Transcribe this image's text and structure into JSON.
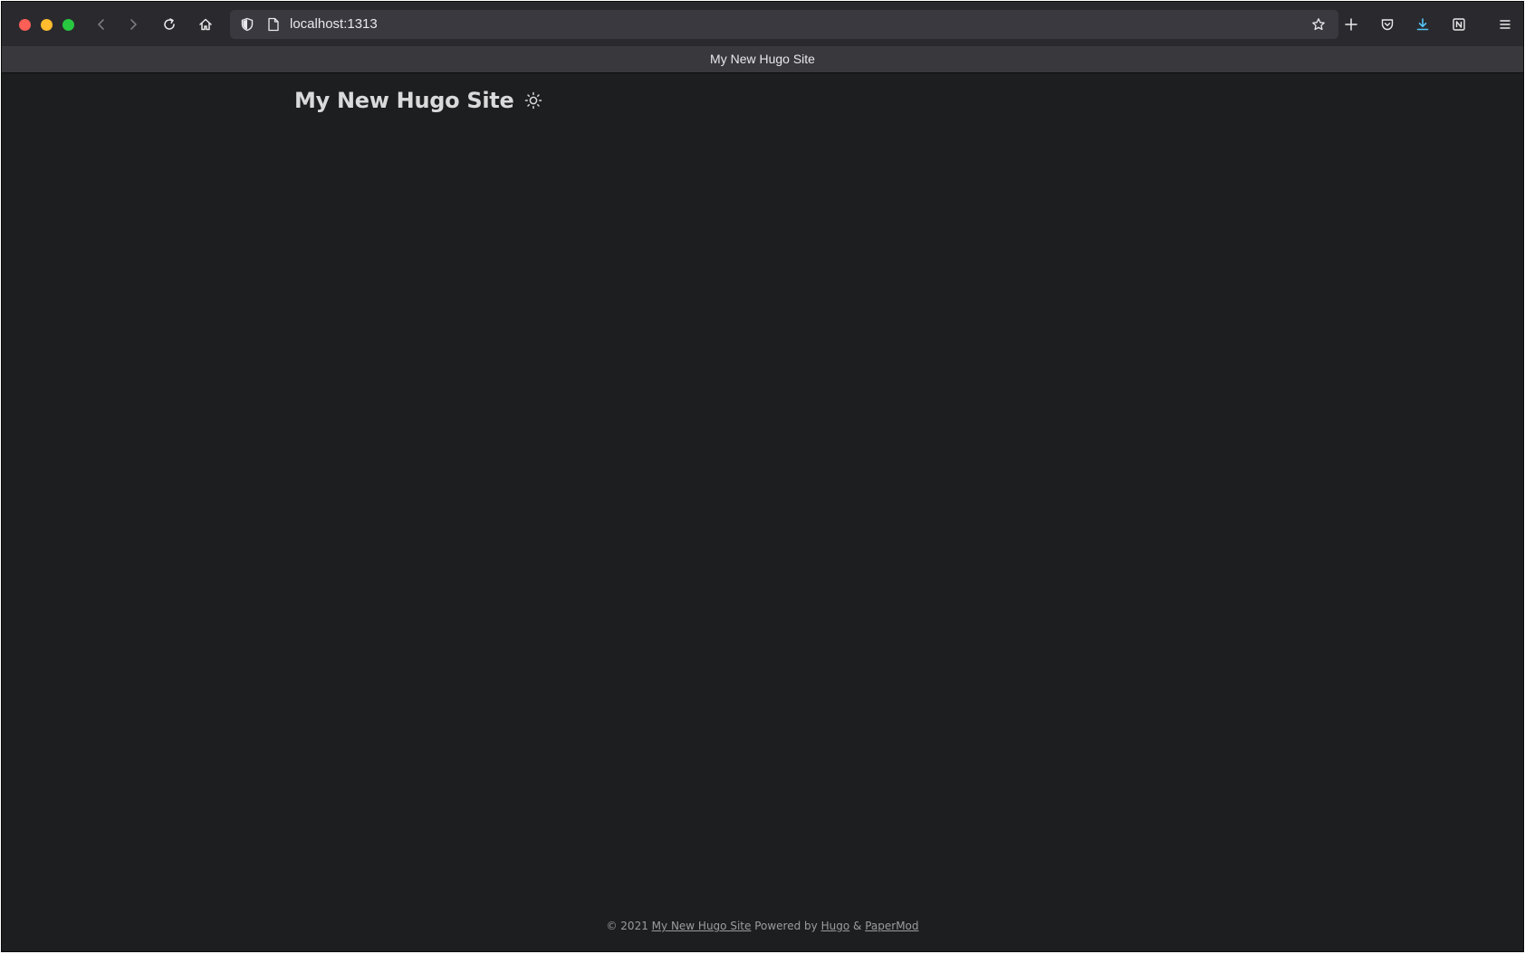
{
  "browser": {
    "url": "localhost:1313",
    "tab_title": "My New Hugo Site"
  },
  "site": {
    "title": "My New Hugo Site"
  },
  "footer": {
    "copyright_prefix": "© 2021",
    "site_link": "My New Hugo Site",
    "powered_by": "Powered by",
    "hugo_link": "Hugo",
    "ampersand": "&",
    "papermod_link": "PaperMod"
  },
  "colors": {
    "page_bg": "#1d1e20",
    "toolbar_bg": "#2a2a2e",
    "text_primary": "#dadadb",
    "text_secondary": "#9b9c9d",
    "download_accent": "#54c5f8"
  }
}
